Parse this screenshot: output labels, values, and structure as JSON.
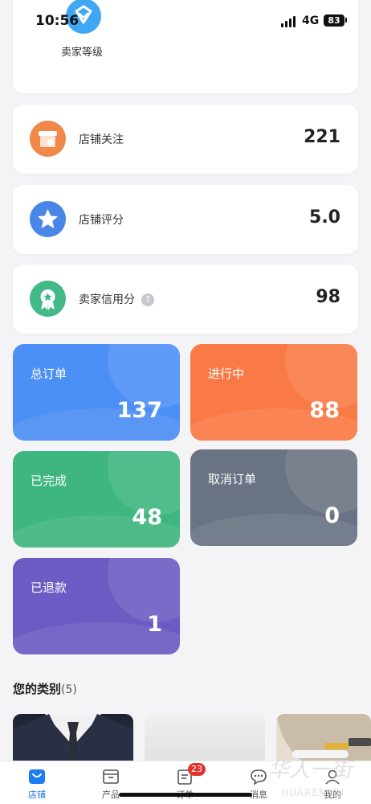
{
  "status_bar": {
    "time": "10:56",
    "network": "4G",
    "battery": "83"
  },
  "level_card": {
    "label": "卖家等级",
    "icon": "diamond-shield-icon"
  },
  "stats": [
    {
      "label": "店铺关注",
      "value": "221",
      "icon": "storefront-icon",
      "color": "#f0884a"
    },
    {
      "label": "店铺评分",
      "value": "5.0",
      "icon": "star-icon",
      "color": "#4a86e8"
    },
    {
      "label": "卖家信用分",
      "value": "98",
      "icon": "award-ribbon-icon",
      "color": "#43b889",
      "help": "?"
    }
  ],
  "order_tiles": [
    {
      "label": "总订单",
      "value": "137",
      "color": "#4c8ff5"
    },
    {
      "label": "进行中",
      "value": "88",
      "color": "#fa7a45"
    },
    {
      "label": "已完成",
      "value": "48",
      "color": "#3fb67f"
    },
    {
      "label": "取消订单",
      "value": "0",
      "color": "#6a7383"
    },
    {
      "label": "已退款",
      "value": "1",
      "color": "#6a5cc2"
    }
  ],
  "categories": {
    "title": "您的类别",
    "count": "(5)"
  },
  "tabbar": {
    "items": [
      {
        "label": "店铺",
        "icon": "shopping-bag-icon",
        "active": true
      },
      {
        "label": "产品",
        "icon": "box-icon"
      },
      {
        "label": "订单",
        "icon": "document-icon",
        "badge": "23"
      },
      {
        "label": "消息",
        "icon": "chat-bubble-icon"
      },
      {
        "label": "我的",
        "icon": "user-icon"
      }
    ]
  },
  "watermark": {
    "text": "华人一街",
    "subtext": "HUARENJIEI"
  }
}
